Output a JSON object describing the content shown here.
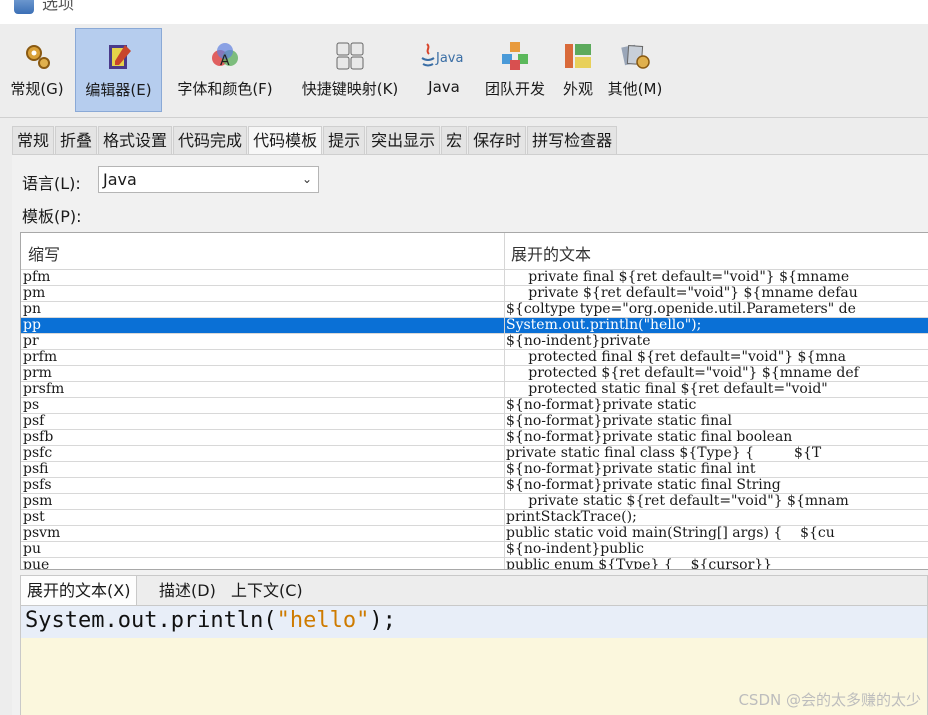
{
  "window": {
    "title": "选项"
  },
  "categories": [
    {
      "label": "常规(G)",
      "icon": "gear-icon",
      "selected": false
    },
    {
      "label": "编辑器(E)",
      "icon": "editor-pen-icon",
      "selected": true
    },
    {
      "label": "字体和颜色(F)",
      "icon": "font-color-icon",
      "selected": false
    },
    {
      "label": "快捷键映射(K)",
      "icon": "keyboard-icon",
      "selected": false
    },
    {
      "label": "Java",
      "icon": "java-icon",
      "selected": false
    },
    {
      "label": "团队开发",
      "icon": "team-cubes-icon",
      "selected": false
    },
    {
      "label": "外观",
      "icon": "appearance-icon",
      "selected": false
    },
    {
      "label": "其他(M)",
      "icon": "misc-icon",
      "selected": false
    }
  ],
  "java_logo_text": "Java",
  "subtabs": [
    "常规",
    "折叠",
    "格式设置",
    "代码完成",
    "代码模板",
    "提示",
    "突出显示",
    "宏",
    "保存时",
    "拼写检查器"
  ],
  "active_subtab": "代码模板",
  "language": {
    "label": "语言(L):",
    "value": "Java"
  },
  "templates_label": "模板(P):",
  "table": {
    "headers": {
      "abbr": "缩写",
      "expanded": "展开的文本"
    },
    "rows": [
      {
        "abbr": "pfm",
        "exp": "     private final ${ret default=\"void\"} ${mname"
      },
      {
        "abbr": "pm",
        "exp": "     private ${ret default=\"void\"} ${mname defau"
      },
      {
        "abbr": "pn",
        "exp": "${coltype type=\"org.openide.util.Parameters\" de"
      },
      {
        "abbr": "pp",
        "exp": "System.out.println(\"hello\");"
      },
      {
        "abbr": "pr",
        "exp": "${no-indent}private"
      },
      {
        "abbr": "prfm",
        "exp": "     protected final ${ret default=\"void\"} ${mna"
      },
      {
        "abbr": "prm",
        "exp": "     protected ${ret default=\"void\"} ${mname def"
      },
      {
        "abbr": "prsfm",
        "exp": "     protected static final ${ret default=\"void\""
      },
      {
        "abbr": "ps",
        "exp": "${no-format}private static"
      },
      {
        "abbr": "psf",
        "exp": "${no-format}private static final"
      },
      {
        "abbr": "psfb",
        "exp": "${no-format}private static final boolean"
      },
      {
        "abbr": "psfc",
        "exp": "private static final class ${Type} {         ${T"
      },
      {
        "abbr": "psfi",
        "exp": "${no-format}private static final int"
      },
      {
        "abbr": "psfs",
        "exp": "${no-format}private static final String"
      },
      {
        "abbr": "psm",
        "exp": "     private static ${ret default=\"void\"} ${mnam"
      },
      {
        "abbr": "pst",
        "exp": "printStackTrace();"
      },
      {
        "abbr": "psvm",
        "exp": "public static void main(String[] args) {    ${cu"
      },
      {
        "abbr": "pu",
        "exp": "${no-indent}public"
      },
      {
        "abbr": "pue",
        "exp": "public enum ${Type} {    ${cursor}}"
      }
    ],
    "selected_abbr": "pp"
  },
  "bottom_tabs": [
    "展开的文本(X)",
    "描述(D)",
    "上下文(C)"
  ],
  "editor": {
    "code_before": "System.out.println(",
    "code_string": "\"hello\"",
    "code_after": ");"
  },
  "watermark": "CSDN @会的太多赚的太少"
}
